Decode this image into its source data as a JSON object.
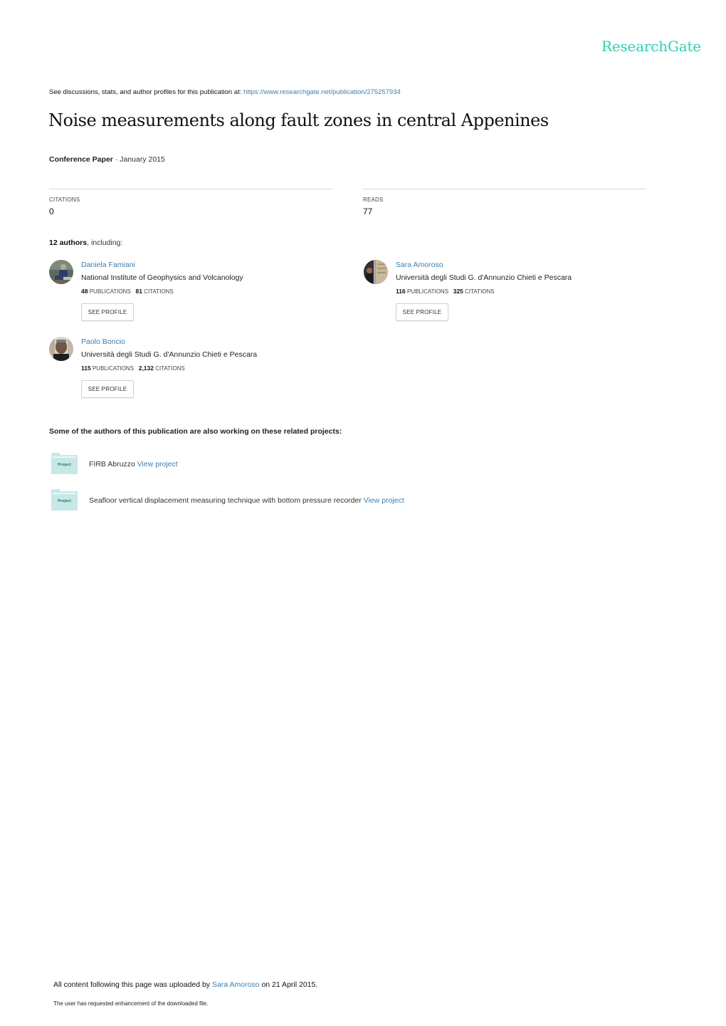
{
  "brand": {
    "logo_text": "ResearchGate",
    "accent_color": "#2ed1b0",
    "link_color": "#3c7fb0"
  },
  "header": {
    "see_discussions_text": "See discussions, stats, and author profiles for this publication at: ",
    "publication_url": "https://www.researchgate.net/publication/275257934"
  },
  "publication": {
    "title": "Noise measurements along fault zones in central Appenines",
    "type": "Conference Paper",
    "separator": " · ",
    "date": "January 2015"
  },
  "stats": {
    "citations_label": "CITATIONS",
    "citations_value": "0",
    "reads_label": "READS",
    "reads_value": "77"
  },
  "authors_intro": {
    "count": "12 authors",
    "suffix": ", including:"
  },
  "authors": [
    {
      "name": "Daniela Famiani",
      "institution": "National Institute of Geophysics and Volcanology",
      "publications": "48",
      "publications_label": "PUBLICATIONS",
      "citations": "81",
      "citations_label": "CITATIONS",
      "button_label": "SEE PROFILE"
    },
    {
      "name": "Sara Amoroso",
      "institution": "Università degli Studi G. d'Annunzio Chieti e Pescara",
      "publications": "116",
      "publications_label": "PUBLICATIONS",
      "citations": "325",
      "citations_label": "CITATIONS",
      "button_label": "SEE PROFILE"
    },
    {
      "name": "Paolo Boncio",
      "institution": "Università degli Studi G. d'Annunzio Chieti e Pescara",
      "publications": "115",
      "publications_label": "PUBLICATIONS",
      "citations": "2,132",
      "citations_label": "CITATIONS",
      "button_label": "SEE PROFILE"
    }
  ],
  "related": {
    "heading": "Some of the authors of this publication are also working on these related projects:",
    "folder_label": "Project",
    "projects": [
      {
        "name": "FIRB Abruzzo",
        "link_label": "View project"
      },
      {
        "name": "Seafloor vertical displacement measuring technique with bottom pressure recorder",
        "link_label": "View project"
      }
    ]
  },
  "footer": {
    "upload_prefix": "All content following this page was uploaded by ",
    "uploader": "Sara Amoroso",
    "upload_suffix": " on 21 April 2015.",
    "note": "The user has requested enhancement of the downloaded file."
  }
}
